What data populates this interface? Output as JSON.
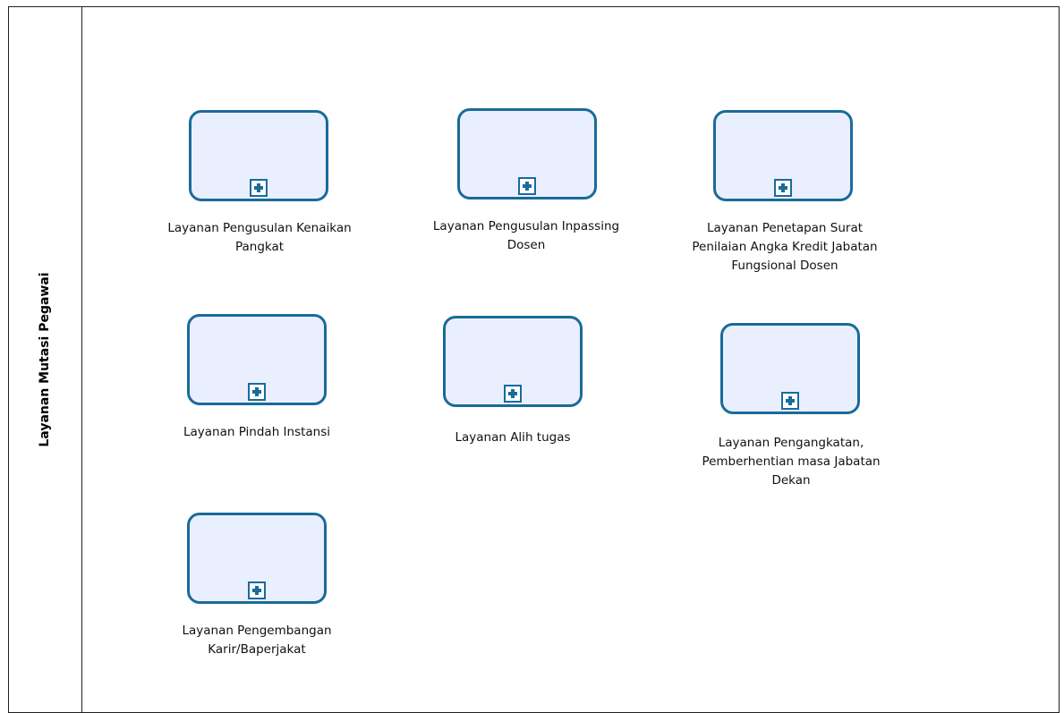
{
  "lane": {
    "title": "Layanan Mutasi Pegawai"
  },
  "tasks": [
    {
      "label": "Layanan Pengusulan Kenaikan\nPangkat"
    },
    {
      "label": "Layanan Pengusulan Inpassing\nDosen"
    },
    {
      "label": "Layanan Penetapan Surat\nPenilaian Angka Kredit Jabatan\nFungsional Dosen"
    },
    {
      "label": "Layanan Pindah Instansi"
    },
    {
      "label": "Layanan Alih tugas"
    },
    {
      "label": "Layanan Pengangkatan,\nPemberhentian masa Jabatan\nDekan"
    },
    {
      "label": "Layanan Pengembangan\nKarir/Baperjakat"
    }
  ],
  "colors": {
    "task_border": "#1a6b9a",
    "task_fill": "#eaefff",
    "pool_border": "#1f1f1f"
  },
  "icons": {
    "subprocess_marker": "plus-marker-icon"
  }
}
